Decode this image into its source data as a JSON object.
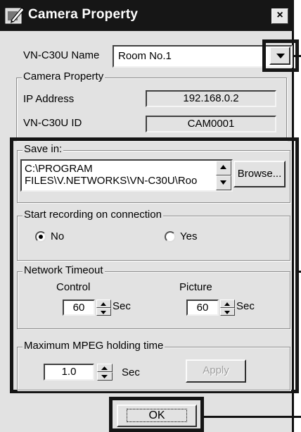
{
  "window": {
    "title": "Camera Property",
    "close_glyph": "×",
    "icon": "camera-pen-icon"
  },
  "name_row": {
    "label": "VN-C30U Name",
    "selected": "Room No.1",
    "dropdown_icon": "triangle-down-icon"
  },
  "camera_property": {
    "group_title": "Camera Property",
    "ip_label": "IP Address",
    "ip_value": "192.168.0.2",
    "id_label": "VN-C30U ID",
    "id_value": "CAM0001"
  },
  "save_in": {
    "group_title": "Save in:",
    "path_line1": "C:\\PROGRAM",
    "path_line2": "FILES\\V.NETWORKS\\VN-C30U\\Roo",
    "browse_label": "Browse..."
  },
  "start_recording": {
    "group_title": "Start recording on connection",
    "options": [
      {
        "label": "No",
        "selected": true
      },
      {
        "label": "Yes",
        "selected": false
      }
    ]
  },
  "network_timeout": {
    "group_title": "Network Timeout",
    "control_label": "Control",
    "control_value": "60",
    "control_unit": "Sec",
    "picture_label": "Picture",
    "picture_value": "60",
    "picture_unit": "Sec"
  },
  "mpeg": {
    "group_title": "Maximum MPEG holding time",
    "value": "1.0",
    "unit": "Sec",
    "apply_label": "Apply"
  },
  "ok_label": "OK",
  "colors": {
    "dialog_bg": "#e2e2e2",
    "title_bar": "#161616",
    "highlight_frame": "#151515",
    "disabled_text": "#a0a0a0"
  }
}
